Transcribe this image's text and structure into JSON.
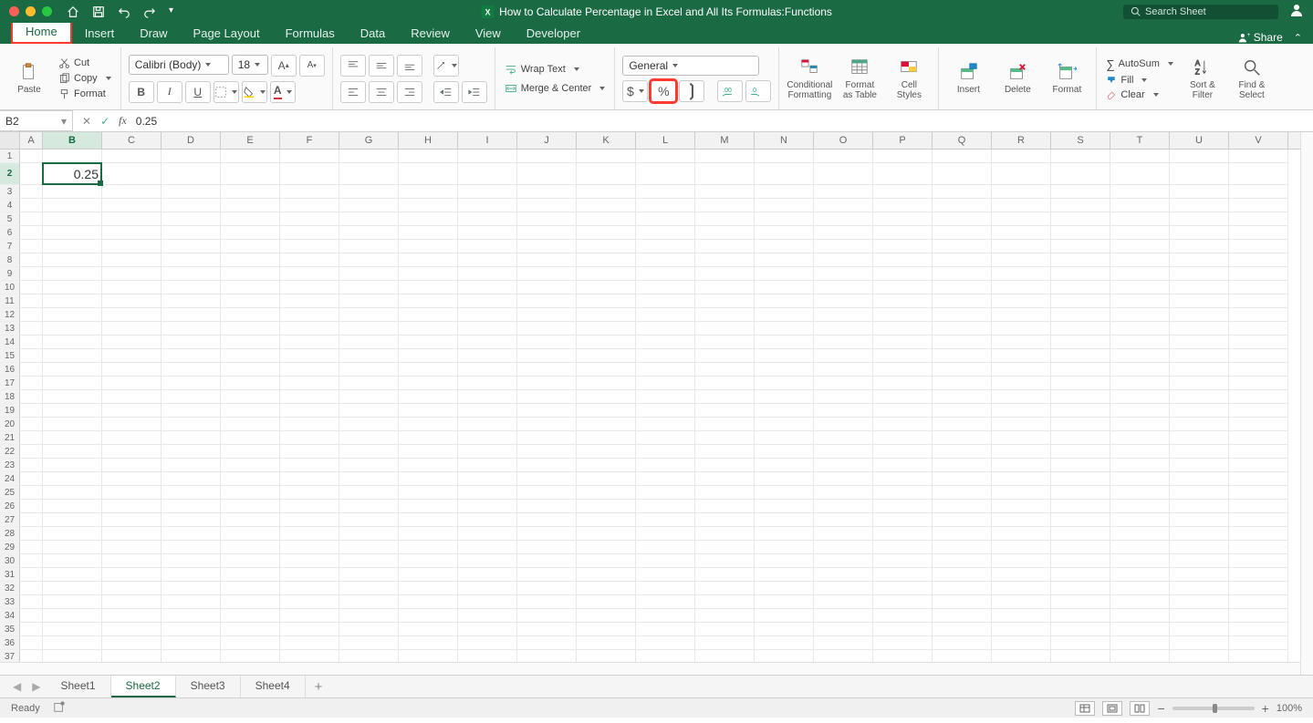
{
  "title": "How to Calculate Percentage in Excel and All Its Formulas:Functions",
  "search_placeholder": "Search Sheet",
  "share_label": "Share",
  "tabs": [
    "Home",
    "Insert",
    "Draw",
    "Page Layout",
    "Formulas",
    "Data",
    "Review",
    "View",
    "Developer"
  ],
  "clipboard": {
    "paste": "Paste",
    "cut": "Cut",
    "copy": "Copy",
    "format": "Format"
  },
  "font": {
    "name": "Calibri (Body)",
    "size": "18"
  },
  "wrap_text": "Wrap Text",
  "merge_center": "Merge & Center",
  "number_format": "General",
  "big_buttons": {
    "cond_fmt": "Conditional\nFormatting",
    "fmt_table": "Format\nas Table",
    "cell_styles": "Cell\nStyles",
    "insert": "Insert",
    "delete": "Delete",
    "format": "Format"
  },
  "editing": {
    "autosum": "AutoSum",
    "fill": "Fill",
    "clear": "Clear",
    "sort": "Sort &\nFilter",
    "find": "Find &\nSelect"
  },
  "namebox": "B2",
  "formula_value": "0.25",
  "columns": [
    "A",
    "B",
    "C",
    "D",
    "E",
    "F",
    "G",
    "H",
    "I",
    "J",
    "K",
    "L",
    "M",
    "N",
    "O",
    "P",
    "Q",
    "R",
    "S",
    "T",
    "U",
    "V"
  ],
  "selected_col": "B",
  "row_count": 37,
  "selected_row": 2,
  "cell_value": "0.25",
  "sheets": [
    "Sheet1",
    "Sheet2",
    "Sheet3",
    "Sheet4"
  ],
  "active_sheet": "Sheet2",
  "status": "Ready",
  "zoom": "100%"
}
